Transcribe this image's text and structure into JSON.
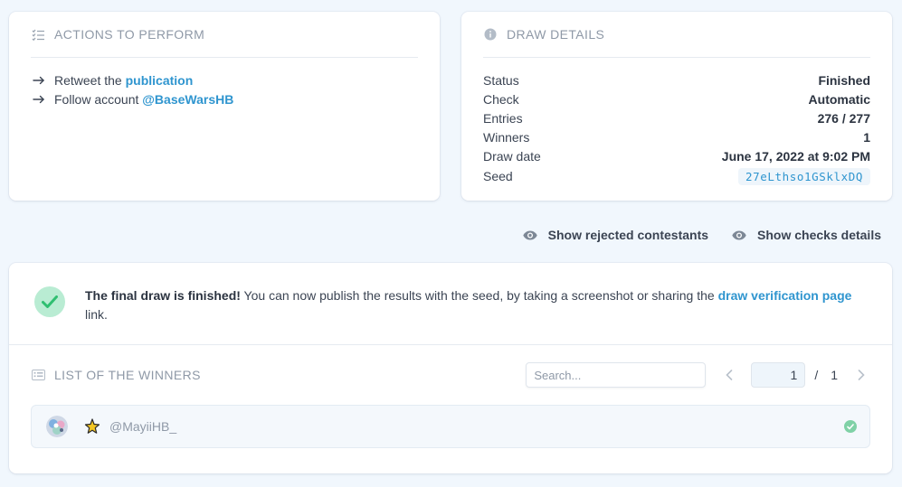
{
  "actions": {
    "title": "ACTIONS TO PERFORM",
    "items": [
      {
        "prefix": "Retweet the ",
        "link": "publication"
      },
      {
        "prefix": "Follow account ",
        "link": "@BaseWarsHB"
      }
    ]
  },
  "draw_details": {
    "title": "DRAW DETAILS",
    "rows": [
      {
        "key": "Status",
        "value": "Finished"
      },
      {
        "key": "Check",
        "value": "Automatic"
      },
      {
        "key": "Entries",
        "value": "276 / 277"
      },
      {
        "key": "Winners",
        "value": "1"
      },
      {
        "key": "Draw date",
        "value": "June 17, 2022 at 9:02 PM"
      },
      {
        "key": "Seed",
        "value": "27eLthso1GSklxDQ"
      }
    ]
  },
  "toggles": {
    "rejected": "Show rejected contestants",
    "checks": "Show checks details"
  },
  "notice": {
    "bold": "The final draw is finished!",
    "text": " You can now publish the results with the seed, by taking a screenshot or sharing the ",
    "link": "draw verification page",
    "suffix": " link."
  },
  "winners": {
    "title": "LIST OF THE WINNERS",
    "search_placeholder": "Search...",
    "page_current": "1",
    "page_sep": "/",
    "page_total": "1",
    "list": [
      {
        "handle": "@MayiiHB_"
      }
    ]
  },
  "colors": {
    "accent": "#2f95cf",
    "success": "#2fbf71",
    "background": "#f1f7fd"
  }
}
